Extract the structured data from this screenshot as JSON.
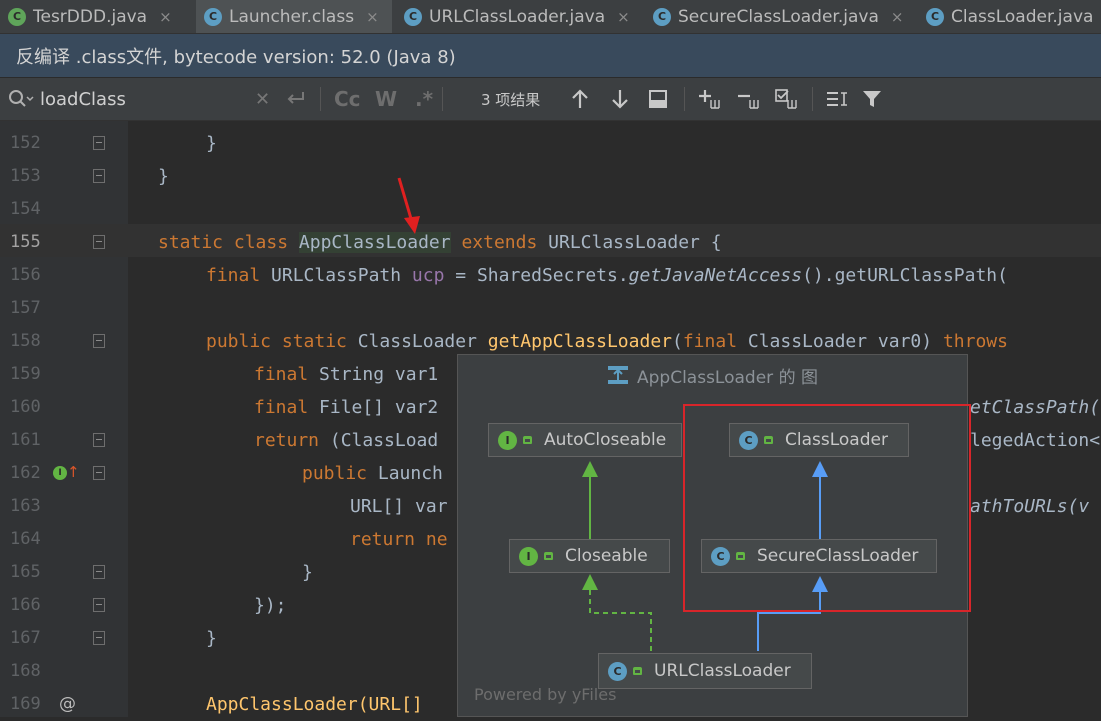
{
  "tabs": [
    {
      "label": "TesrDDD.java",
      "icon": "green",
      "close": "×"
    },
    {
      "label": "Launcher.class",
      "icon": "blue",
      "close": "×"
    },
    {
      "label": "URLClassLoader.java",
      "icon": "blue",
      "close": "×"
    },
    {
      "label": "SecureClassLoader.java",
      "icon": "blue",
      "close": "×"
    },
    {
      "label": "ClassLoader.java",
      "icon": "blue",
      "close": ""
    }
  ],
  "banner": {
    "text": "反编译 .class文件, bytecode version: 52.0 (Java 8)"
  },
  "search": {
    "query": "loadClass",
    "results": "3 项结果",
    "case_label": "Cc",
    "word_label": "W",
    "regex_label": ".*"
  },
  "line_numbers": [
    "152",
    "153",
    "154",
    "155",
    "156",
    "157",
    "158",
    "159",
    "160",
    "161",
    "162",
    "163",
    "164",
    "165",
    "166",
    "167",
    "168",
    "169"
  ],
  "code": {
    "l152": "}",
    "l153": "}",
    "l155": {
      "k1": "static class ",
      "name": "AppClassLoader",
      "k2": " extends ",
      "rest": "URLClassLoader {"
    },
    "l156": {
      "k1": "final ",
      "t": "URLClassPath ",
      "f": "ucp",
      "eq": " = SharedSecrets.",
      "m": "getJavaNetAccess",
      "rest": "().getURLClassPath("
    },
    "l158": {
      "k1": "public static ",
      "t": "ClassLoader ",
      "m": "getAppClassLoader",
      "p1": "(",
      "k2": "final ",
      "p2": "ClassLoader var0) ",
      "k3": "throws"
    },
    "l159": {
      "k1": "final ",
      "rest": "String var1"
    },
    "l160": {
      "k1": "final ",
      "rest": "File[] var2",
      "right": "etClassPath("
    },
    "l161": {
      "k1": "return ",
      "rest": "(ClassLoad",
      "right": "legedAction<"
    },
    "l162": {
      "k1": "public ",
      "rest": "Launch"
    },
    "l163": {
      "rest": "URL[] var",
      "right": "athToURLs(v"
    },
    "l164": {
      "k1": "return ",
      "k2": "ne"
    },
    "l165": "}",
    "l166": "});",
    "l167": "}",
    "l169": {
      "rest": "AppClassLoader(URL[]"
    }
  },
  "popup": {
    "title": "AppClassLoader 的 图",
    "nodes": {
      "autocloseable": "AutoCloseable",
      "classloader": "ClassLoader",
      "closeable": "Closeable",
      "secureclassloader": "SecureClassLoader",
      "urlclassloader": "URLClassLoader"
    },
    "interface_badge": "I",
    "class_badge": "C",
    "powered": "Powered by yFiles"
  },
  "gutter": {
    "at_sign": "@",
    "impl_marker": "I"
  },
  "colors": {
    "keyword": "#cc7832",
    "method": "#ffc66d",
    "field": "#9876aa",
    "highlight": "#d8252a",
    "arrow_green": "#62b543",
    "arrow_blue": "#589df6"
  }
}
